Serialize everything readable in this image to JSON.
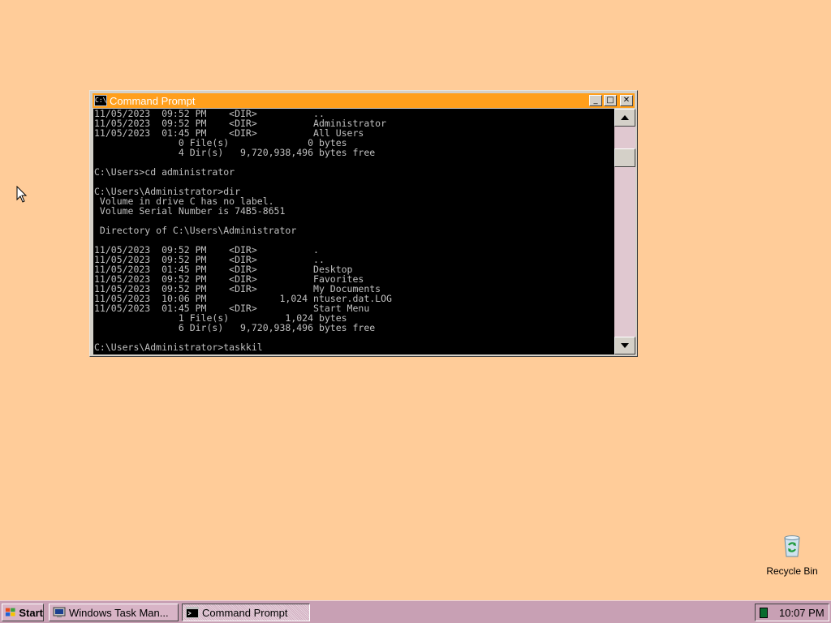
{
  "window": {
    "title": "Command Prompt",
    "controls": {
      "minimize": "_",
      "maximize": "□",
      "close": "✕"
    }
  },
  "console": {
    "lines": [
      "11/05/2023  09:52 PM    <DIR>          ..",
      "11/05/2023  09:52 PM    <DIR>          Administrator",
      "11/05/2023  01:45 PM    <DIR>          All Users",
      "               0 File(s)              0 bytes",
      "               4 Dir(s)   9,720,938,496 bytes free",
      "",
      "C:\\Users>cd administrator",
      "",
      "C:\\Users\\Administrator>dir",
      " Volume in drive C has no label.",
      " Volume Serial Number is 74B5-8651",
      "",
      " Directory of C:\\Users\\Administrator",
      "",
      "11/05/2023  09:52 PM    <DIR>          .",
      "11/05/2023  09:52 PM    <DIR>          ..",
      "11/05/2023  01:45 PM    <DIR>          Desktop",
      "11/05/2023  09:52 PM    <DIR>          Favorites",
      "11/05/2023  09:52 PM    <DIR>          My Documents",
      "11/05/2023  10:06 PM             1,024 ntuser.dat.LOG",
      "11/05/2023  01:45 PM    <DIR>          Start Menu",
      "               1 File(s)          1,024 bytes",
      "               6 Dir(s)   9,720,938,496 bytes free",
      "",
      "C:\\Users\\Administrator>taskkil"
    ]
  },
  "desktop": {
    "recycle_bin_label": "Recycle Bin"
  },
  "taskbar": {
    "start_label": "Start",
    "tasks": [
      {
        "label": "Windows Task Man..."
      },
      {
        "label": "Command Prompt"
      }
    ],
    "clock": "10:07 PM"
  },
  "colors": {
    "desktop": "#ffcc99",
    "titlebar": "#ff9f1c",
    "taskbar": "#c8a0b4",
    "console_bg": "#000000",
    "console_fg": "#c0c0c0"
  },
  "icons": {
    "cursor": "arrow-cursor-icon",
    "cmd": "command-prompt-icon",
    "taskmgr": "task-manager-icon",
    "start": "windows-flag-icon",
    "recycle": "recycle-bin-icon",
    "tray": "network-icon"
  }
}
